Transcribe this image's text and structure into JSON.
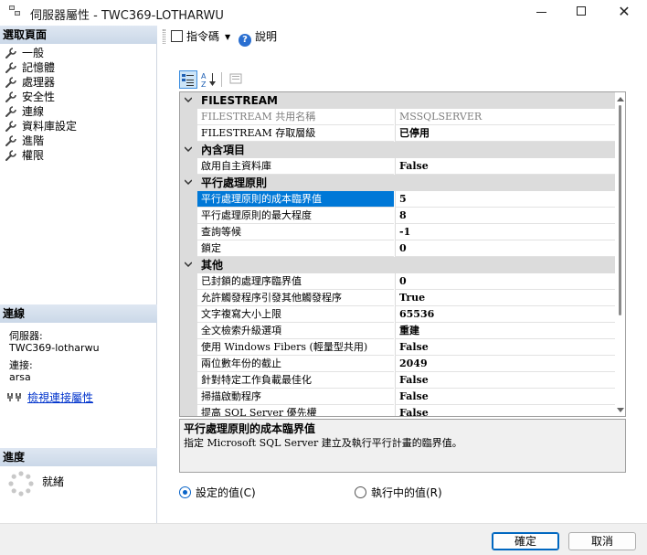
{
  "window": {
    "title": "伺服器屬性 - TWC369-LOTHARWU"
  },
  "left_panel": {
    "select_page_header": "選取頁面",
    "pages": [
      {
        "label": "一般"
      },
      {
        "label": "記憶體"
      },
      {
        "label": "處理器"
      },
      {
        "label": "安全性"
      },
      {
        "label": "連線"
      },
      {
        "label": "資料庫設定"
      },
      {
        "label": "進階"
      },
      {
        "label": "權限"
      }
    ],
    "connection_header": "連線",
    "server_label": "伺服器:",
    "server_value": "TWC369-lotharwu",
    "connection_label": "連接:",
    "connection_value": "arsa",
    "view_connection_link": "檢視連接屬性",
    "progress_header": "進度",
    "progress_status": "就緒"
  },
  "toolbar": {
    "script_label": "指令碼",
    "help_label": "說明"
  },
  "grid": {
    "rows": [
      {
        "type": "category",
        "label": "FILESTREAM"
      },
      {
        "type": "prop",
        "name": "FILESTREAM 共用名稱",
        "value": "MSSQLSERVER",
        "readonly": true
      },
      {
        "type": "prop",
        "name": "FILESTREAM 存取層級",
        "value": "已停用"
      },
      {
        "type": "category",
        "label": "內含項目"
      },
      {
        "type": "prop",
        "name": "啟用自主資料庫",
        "value": "False"
      },
      {
        "type": "category",
        "label": "平行處理原則"
      },
      {
        "type": "prop",
        "name": "平行處理原則的成本臨界值",
        "value": "5",
        "selected": true
      },
      {
        "type": "prop",
        "name": "平行處理原則的最大程度",
        "value": "8"
      },
      {
        "type": "prop",
        "name": "查詢等候",
        "value": "-1"
      },
      {
        "type": "prop",
        "name": "鎖定",
        "value": "0"
      },
      {
        "type": "category",
        "label": "其他"
      },
      {
        "type": "prop",
        "name": "已封鎖的處理序臨界值",
        "value": "0"
      },
      {
        "type": "prop",
        "name": "允許觸發程序引發其他觸發程序",
        "value": "True"
      },
      {
        "type": "prop",
        "name": "文字複寫大小上限",
        "value": "65536"
      },
      {
        "type": "prop",
        "name": "全文檢索升級選項",
        "value": "重建"
      },
      {
        "type": "prop",
        "name": "使用 Windows Fibers (輕量型共用)",
        "value": "False"
      },
      {
        "type": "prop",
        "name": "兩位數年份的截止",
        "value": "2049"
      },
      {
        "type": "prop",
        "name": "針對特定工作負載最佳化",
        "value": "False"
      },
      {
        "type": "prop",
        "name": "掃描啟動程序",
        "value": "False"
      },
      {
        "type": "prop",
        "name": "提高 SQL Server 優先權",
        "value": "False"
      }
    ]
  },
  "description": {
    "title": "平行處理原則的成本臨界值",
    "text": "指定 Microsoft SQL Server 建立及執行平行計畫的臨界值。"
  },
  "options": {
    "configured_label": "設定的值(C)",
    "running_label": "執行中的值(R)",
    "selected": "configured"
  },
  "buttons": {
    "ok_label": "確定",
    "cancel_label": "取消"
  },
  "colors": {
    "selection": "#0078d7",
    "category_bg": "#dcdcdc",
    "link": "#0033cc",
    "header_gradient": "#cbd8e8"
  }
}
